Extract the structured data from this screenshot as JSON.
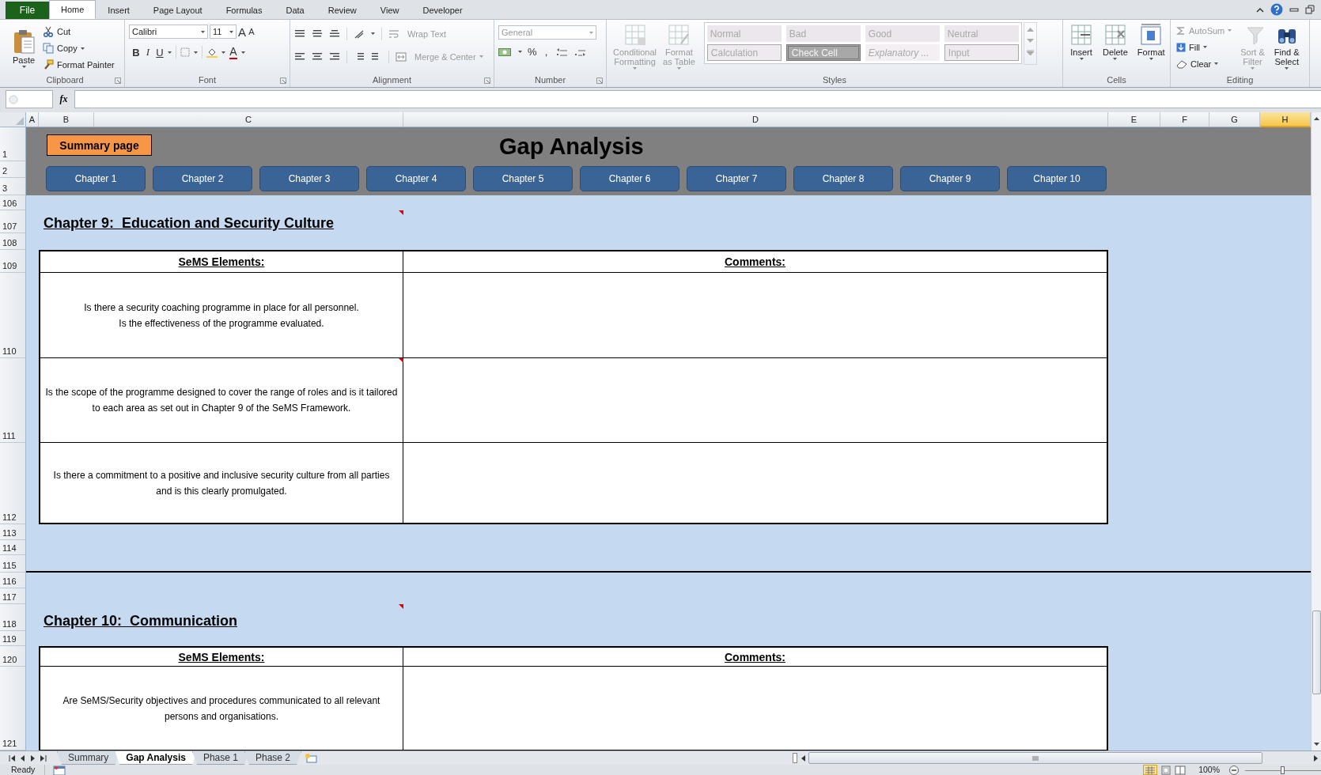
{
  "ribbon_tabs": [
    {
      "label": "File",
      "kind": "file",
      "selected": false
    },
    {
      "label": "Home",
      "kind": "tab",
      "selected": true
    },
    {
      "label": "Insert",
      "kind": "tab",
      "selected": false
    },
    {
      "label": "Page Layout",
      "kind": "tab",
      "selected": false
    },
    {
      "label": "Formulas",
      "kind": "tab",
      "selected": false
    },
    {
      "label": "Data",
      "kind": "tab",
      "selected": false
    },
    {
      "label": "Review",
      "kind": "tab",
      "selected": false
    },
    {
      "label": "View",
      "kind": "tab",
      "selected": false
    },
    {
      "label": "Developer",
      "kind": "tab",
      "selected": false
    }
  ],
  "ribbon_groups": [
    {
      "kind": "clipboard",
      "title": "Clipboard",
      "launcher": true,
      "items": [
        {
          "label": "Paste",
          "kind": "large",
          "dropdown": true
        },
        {
          "label": "Cut",
          "kind": "small"
        },
        {
          "label": "Copy",
          "kind": "small",
          "dropdown": true
        },
        {
          "label": "Format Painter",
          "kind": "small"
        }
      ]
    },
    {
      "kind": "font",
      "title": "Font",
      "launcher": true,
      "font_name": "Calibri",
      "font_size": "11",
      "size_buttons": [
        "A",
        "A"
      ],
      "format_buttons": [
        "B",
        "I",
        "U"
      ],
      "color_button": "A"
    },
    {
      "kind": "alignment",
      "title": "Alignment",
      "launcher": true,
      "items": [
        {
          "label": "Wrap Text",
          "kind": "small",
          "disabled": true
        },
        {
          "label": "Merge & Center",
          "kind": "small",
          "disabled": true,
          "dropdown": true
        }
      ]
    },
    {
      "kind": "number",
      "title": "Number",
      "launcher": true,
      "format": "General",
      "format_disabled": true,
      "symbols": [
        "%",
        ","
      ]
    },
    {
      "kind": "styles",
      "title": "Styles",
      "items": [
        {
          "label": "Conditional\nFormatting",
          "kind": "large",
          "disabled": true,
          "dropdown": true
        },
        {
          "label": "Format\nas Table",
          "kind": "large",
          "disabled": true,
          "dropdown": true
        }
      ],
      "gallery_disabled": true,
      "gallery": [
        {
          "label": "Normal",
          "kind": "normal"
        },
        {
          "label": "Bad",
          "kind": "bad"
        },
        {
          "label": "Good",
          "kind": "good"
        },
        {
          "label": "Neutral",
          "kind": "neutral"
        },
        {
          "label": "Calculation",
          "kind": "calculation"
        },
        {
          "label": "Check Cell",
          "kind": "check"
        },
        {
          "label": "Explanatory ...",
          "kind": "explanatory"
        },
        {
          "label": "Input",
          "kind": "input"
        }
      ]
    },
    {
      "kind": "cells",
      "title": "Cells",
      "items": [
        {
          "label": "Insert",
          "kind": "large",
          "dropdown": true
        },
        {
          "label": "Delete",
          "kind": "large",
          "dropdown": true
        },
        {
          "label": "Format",
          "kind": "large",
          "dropdown": true
        }
      ]
    },
    {
      "kind": "editing",
      "title": "Editing",
      "items": [
        {
          "label": "AutoSum",
          "kind": "small",
          "disabled": true,
          "dropdown": true
        },
        {
          "label": "Fill",
          "kind": "small",
          "dropdown": true
        },
        {
          "label": "Clear",
          "kind": "small",
          "dropdown": true
        },
        {
          "label": "Sort &\nFilter",
          "kind": "large",
          "disabled": true,
          "dropdown": true
        },
        {
          "label": "Find &\nSelect",
          "kind": "large",
          "dropdown": true
        }
      ]
    }
  ],
  "formula_bar": {
    "function_label": "fx"
  },
  "columns": [
    {
      "label": "A",
      "selected": false
    },
    {
      "label": "B",
      "selected": false
    },
    {
      "label": "C",
      "selected": false
    },
    {
      "label": "D",
      "selected": false
    },
    {
      "label": "E",
      "selected": false
    },
    {
      "label": "F",
      "selected": false
    },
    {
      "label": "G",
      "selected": false
    },
    {
      "label": "H",
      "selected": true
    }
  ],
  "row_numbers": [
    "1",
    "2",
    "3",
    "106",
    "107",
    "108",
    "109",
    "110",
    "111",
    "112",
    "113",
    "114",
    "115",
    "116",
    "117",
    "118",
    "119",
    "120",
    "121"
  ],
  "banner": {
    "summary_button": "Summary page",
    "title": "Gap Analysis",
    "chapter_buttons": [
      "Chapter 1",
      "Chapter 2",
      "Chapter 3",
      "Chapter 4",
      "Chapter 5",
      "Chapter 6",
      "Chapter 7",
      "Chapter 8",
      "Chapter 9",
      "Chapter 10"
    ]
  },
  "sections": [
    {
      "heading": "Chapter 9:  Education and Security Culture",
      "commented": true,
      "columns": [
        "SeMS Elements:",
        "Comments:"
      ],
      "rows": [
        {
          "element": "Is there a security coaching programme in place for all personnel.\nIs the effectiveness of the programme evaluated.",
          "commented": false
        },
        {
          "element": "Is the scope of the programme designed to cover the range of roles and is it tailored to each area as set out in Chapter 9 of the SeMS Framework.",
          "commented": true
        },
        {
          "element": "Is there a commitment to a positive and inclusive security culture from all parties and is this clearly promulgated.",
          "commented": false
        }
      ]
    },
    {
      "heading": "Chapter 10:  Communication",
      "commented": true,
      "columns": [
        "SeMS Elements:",
        "Comments:"
      ],
      "rows": [
        {
          "element": "Are SeMS/Security objectives and procedures communicated to all relevant persons and organisations.",
          "commented": false
        }
      ]
    }
  ],
  "sheet_tabs": [
    {
      "label": "Summary",
      "selected": false
    },
    {
      "label": "Gap Analysis",
      "selected": true
    },
    {
      "label": "Phase 1",
      "selected": false
    },
    {
      "label": "Phase 2",
      "selected": false
    }
  ],
  "status_bar": {
    "status": "Ready",
    "zoom": {
      "label": "100%",
      "level": 0.5
    }
  }
}
